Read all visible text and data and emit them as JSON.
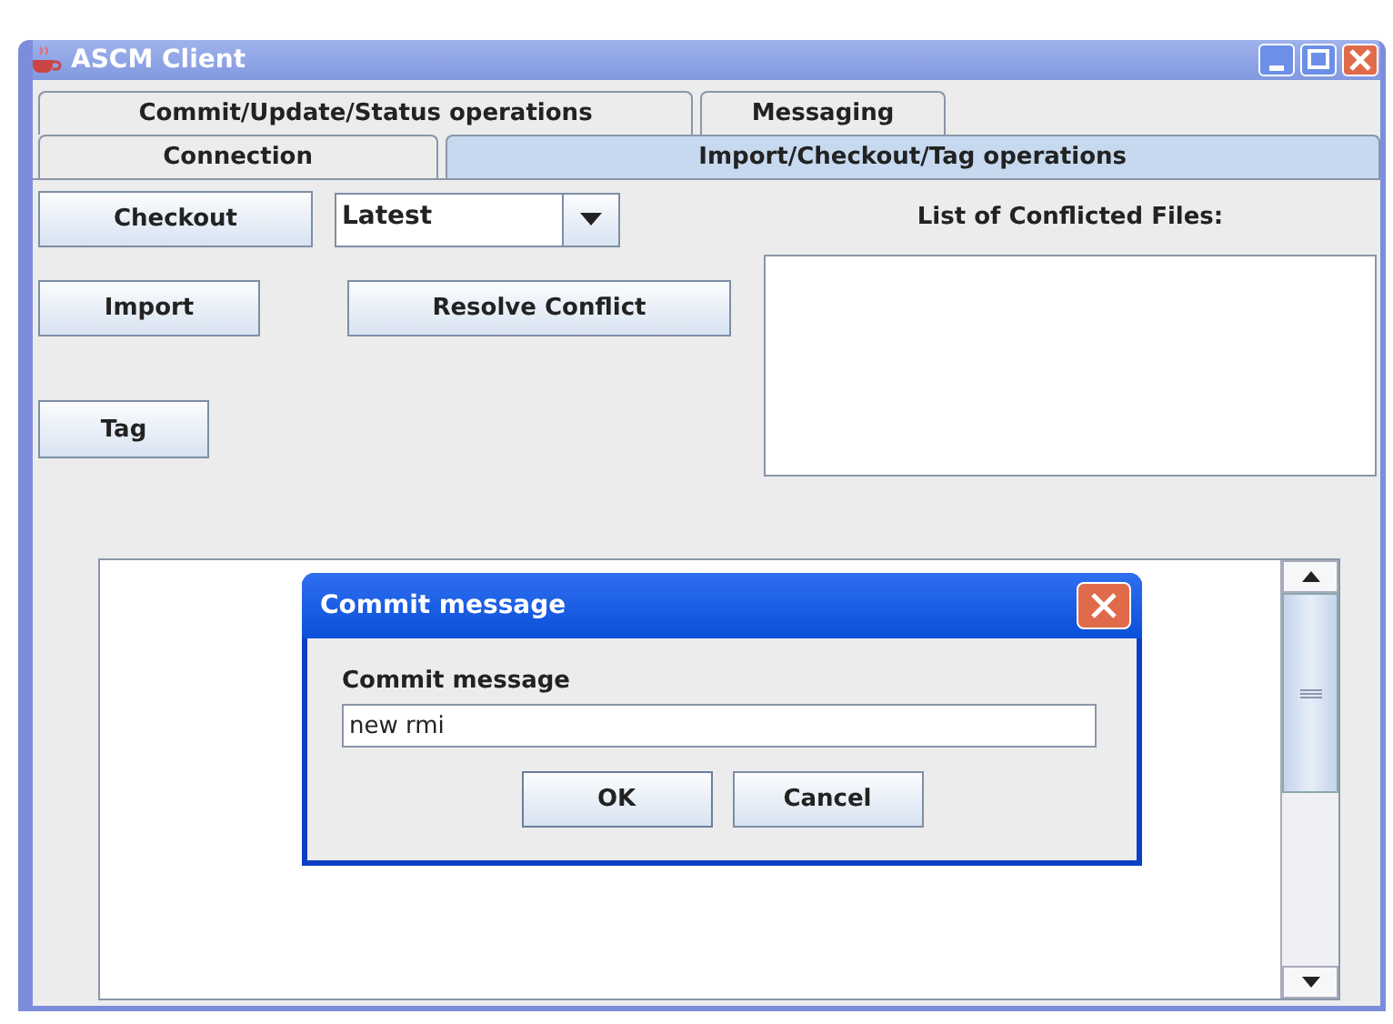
{
  "window": {
    "title": "ASCM Client"
  },
  "tab_rows": [
    [
      {
        "label": "Commit/Update/Status operations",
        "selected": false
      },
      {
        "label": "Messaging",
        "selected": false
      }
    ],
    [
      {
        "label": "Connection",
        "selected": false
      },
      {
        "label": "Import/Checkout/Tag operations",
        "selected": true
      }
    ]
  ],
  "panel": {
    "checkout_button": "Checkout",
    "version_combo": {
      "value": "Latest"
    },
    "import_button": "Import",
    "resolve_button": "Resolve Conflict",
    "tag_button": "Tag",
    "conflicts_label": "List of Conflicted Files:"
  },
  "dialog": {
    "title": "Commit message",
    "label": "Commit message",
    "field": {
      "value": "new rmi"
    },
    "buttons": [
      "OK",
      "Cancel"
    ]
  }
}
